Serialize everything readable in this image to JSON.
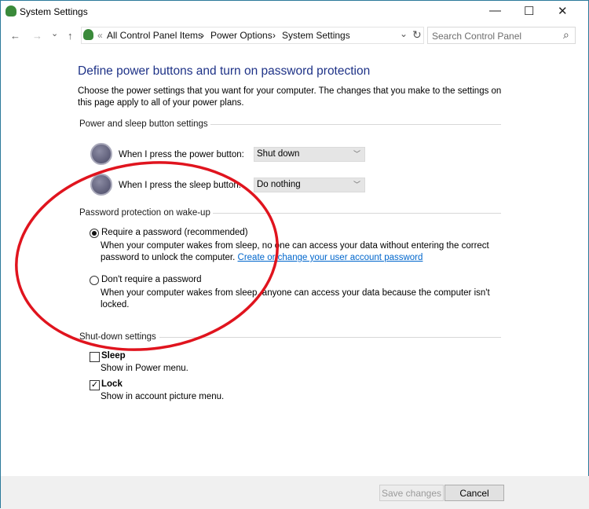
{
  "window": {
    "title": "System Settings",
    "minimize": "—",
    "maximize": "☐",
    "close": "✕"
  },
  "nav": {
    "back": "←",
    "forward": "→",
    "recent": "⌄",
    "up": "↑",
    "breadcrumb": [
      "All Control Panel Items",
      "Power Options",
      "System Settings"
    ],
    "sep": "›",
    "overflow": "«",
    "dropdown": "⌄",
    "refresh": "↻"
  },
  "search": {
    "placeholder": "Search Control Panel",
    "icon": "⌕"
  },
  "page": {
    "heading": "Define power buttons and turn on password protection",
    "intro_line1": "Choose the power settings that you want for your computer. The changes that you make to the settings on",
    "intro_line2": "this page apply to all of your power plans."
  },
  "power": {
    "section": "Power and sleep button settings",
    "power_label": "When I press the power button:",
    "power_value": "Shut down",
    "sleep_label": "When I press the sleep button:",
    "sleep_value": "Do nothing"
  },
  "password": {
    "section": "Password protection on wake-up",
    "require_label": "Require a password (recommended)",
    "require_selected": true,
    "require_desc1": "When your computer wakes from sleep, no one can access your data without entering the correct",
    "require_desc2": "password to unlock the computer.",
    "link": "Create or change your user account password",
    "norequire_label": "Don't require a password",
    "norequire_desc1": "When your computer wakes from sleep, anyone can access your data because the computer isn't",
    "norequire_desc2": "locked."
  },
  "shutdown": {
    "section": "Shut-down settings",
    "sleep_label": "Sleep",
    "sleep_desc": "Show in Power menu.",
    "sleep_checked": false,
    "lock_label": "Lock",
    "lock_desc": "Show in account picture menu.",
    "lock_checked": true,
    "check": "✓"
  },
  "buttons": {
    "save": "Save changes",
    "cancel": "Cancel"
  },
  "annotation_color": "#e0141e"
}
